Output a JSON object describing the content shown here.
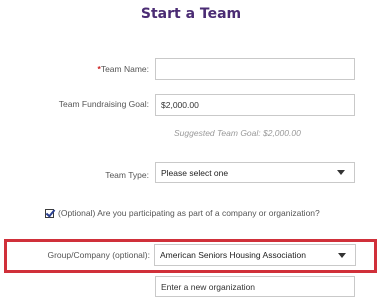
{
  "page": {
    "title": "Start a Team"
  },
  "form": {
    "team_name": {
      "required_mark": "*",
      "label": "Team Name:",
      "value": ""
    },
    "fundraising_goal": {
      "label": "Team Fundraising Goal:",
      "value": "$2,000.00",
      "hint": "Suggested Team Goal: $2,000.00"
    },
    "team_type": {
      "label": "Team Type:",
      "selected": "Please select one"
    },
    "company_checkbox": {
      "checked": true,
      "label": "(Optional) Are you participating as part of a company or organization?"
    },
    "group_company": {
      "label": "Group/Company (optional):",
      "selected": "American Seniors Housing Association"
    },
    "new_organization": {
      "value": "Enter a new organization"
    }
  },
  "colors": {
    "title": "#4b2c74",
    "required": "#cc1f1f",
    "highlight_border": "#d0303a"
  },
  "icons": {
    "dropdown": "chevron-down-icon",
    "checkbox": "checkmark-icon"
  }
}
